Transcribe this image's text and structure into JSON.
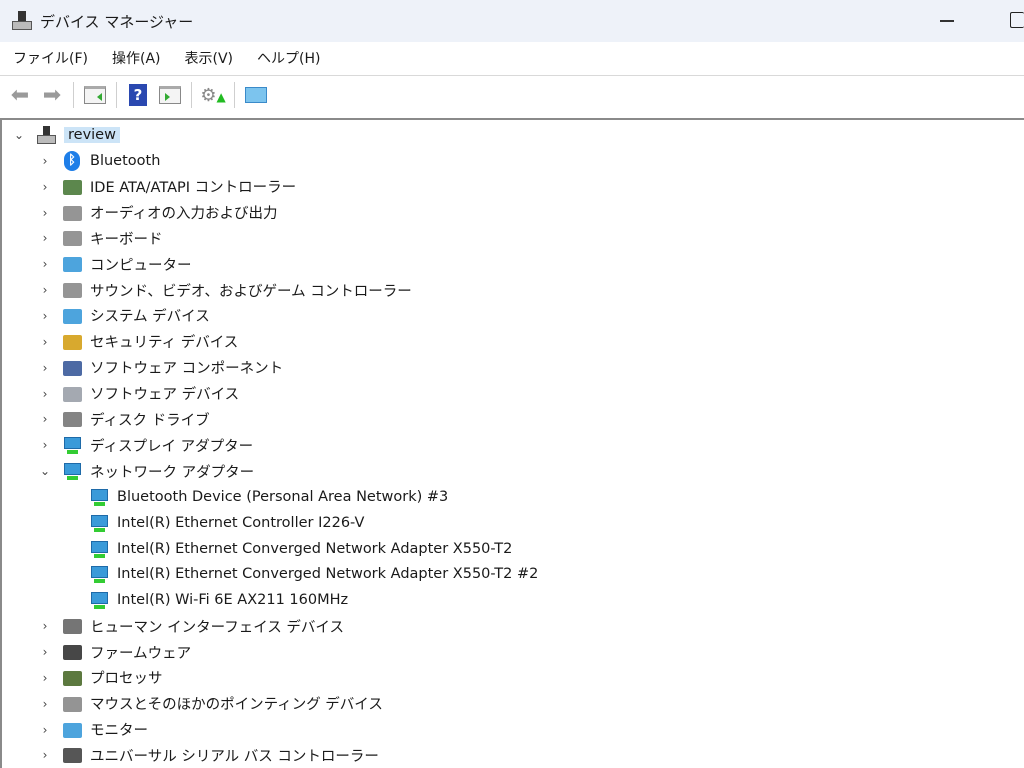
{
  "window": {
    "title": "デバイス マネージャー"
  },
  "menu": [
    "ファイル(F)",
    "操作(A)",
    "表示(V)",
    "ヘルプ(H)"
  ],
  "toolbar": [
    "back",
    "forward",
    "show-hide-console-tree",
    "help",
    "show-hide-action-pane",
    "update-driver",
    "scan-hardware"
  ],
  "tree": {
    "root": "review",
    "categories": [
      {
        "label": "Bluetooth",
        "icon": "bluetooth-icon",
        "color": "#1e7ee8"
      },
      {
        "label": "IDE ATA/ATAPI コントローラー",
        "icon": "ide-controller-icon",
        "color": "#4a7a3a"
      },
      {
        "label": "オーディオの入力および出力",
        "icon": "speaker-icon",
        "color": "#8a8a8a"
      },
      {
        "label": "キーボード",
        "icon": "keyboard-icon",
        "color": "#8a8a8a"
      },
      {
        "label": "コンピューター",
        "icon": "computer-icon",
        "color": "#3a9ad9"
      },
      {
        "label": "サウンド、ビデオ、およびゲーム コントローラー",
        "icon": "speaker-icon",
        "color": "#8a8a8a"
      },
      {
        "label": "システム デバイス",
        "icon": "system-device-icon",
        "color": "#3a9ad9"
      },
      {
        "label": "セキュリティ デバイス",
        "icon": "security-key-icon",
        "color": "#d4a017"
      },
      {
        "label": "ソフトウェア コンポーネント",
        "icon": "software-component-icon",
        "color": "#3a5a9a"
      },
      {
        "label": "ソフトウェア デバイス",
        "icon": "software-device-icon",
        "color": "#9aa0a8"
      },
      {
        "label": "ディスク ドライブ",
        "icon": "disk-drive-icon",
        "color": "#777777"
      },
      {
        "label": "ディスプレイ アダプター",
        "icon": "display-adapter-icon",
        "color": "#3a9ad9"
      },
      {
        "label": "ネットワーク アダプター",
        "icon": "network-adapter-icon",
        "color": "#3a9ad9",
        "expanded": true,
        "children": [
          "Bluetooth Device (Personal Area Network) #3",
          "Intel(R) Ethernet Controller I226-V",
          "Intel(R) Ethernet Converged Network Adapter X550-T2",
          "Intel(R) Ethernet Converged Network Adapter X550-T2 #2",
          "Intel(R) Wi-Fi 6E AX211 160MHz"
        ]
      },
      {
        "label": "ヒューマン インターフェイス デバイス",
        "icon": "hid-icon",
        "color": "#666666"
      },
      {
        "label": "ファームウェア",
        "icon": "firmware-icon",
        "color": "#333333"
      },
      {
        "label": "プロセッサ",
        "icon": "processor-icon",
        "color": "#4a6a2a"
      },
      {
        "label": "マウスとそのほかのポインティング デバイス",
        "icon": "mouse-icon",
        "color": "#888888"
      },
      {
        "label": "モニター",
        "icon": "monitor-icon",
        "color": "#3a9ad9"
      },
      {
        "label": "ユニバーサル シリアル バス コントローラー",
        "icon": "usb-icon",
        "color": "#444444"
      }
    ]
  }
}
